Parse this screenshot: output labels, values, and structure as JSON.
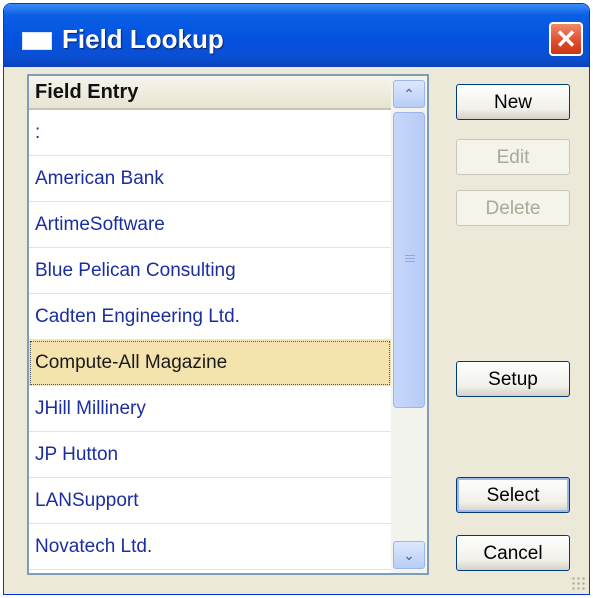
{
  "window": {
    "title": "Field Lookup",
    "close_glyph": "✕"
  },
  "list": {
    "header": "Field Entry",
    "items": [
      ":",
      "American Bank",
      "ArtimeSoftware",
      "Blue Pelican Consulting",
      "Cadten Engineering Ltd.",
      "Compute-All Magazine",
      "JHill Millinery",
      "JP Hutton",
      "LANSupport",
      "Novatech Ltd."
    ],
    "selected_item": "Compute-All Magazine",
    "scroll_up_glyph": "⌃",
    "scroll_down_glyph": "⌄"
  },
  "buttons": {
    "new": "New",
    "edit": "Edit",
    "delete": "Delete",
    "setup": "Setup",
    "select": "Select",
    "cancel": "Cancel"
  },
  "icons": {
    "title_icon": "window-icon",
    "close": "close-icon",
    "scroll_up": "chevron-up-icon",
    "scroll_down": "chevron-down-icon",
    "resize": "resize-grip-icon"
  },
  "colors": {
    "titlebar": "#0552df",
    "selection": "#f4e3ad",
    "close_button": "#e0492a",
    "dialog_background": "#ece9d8"
  }
}
